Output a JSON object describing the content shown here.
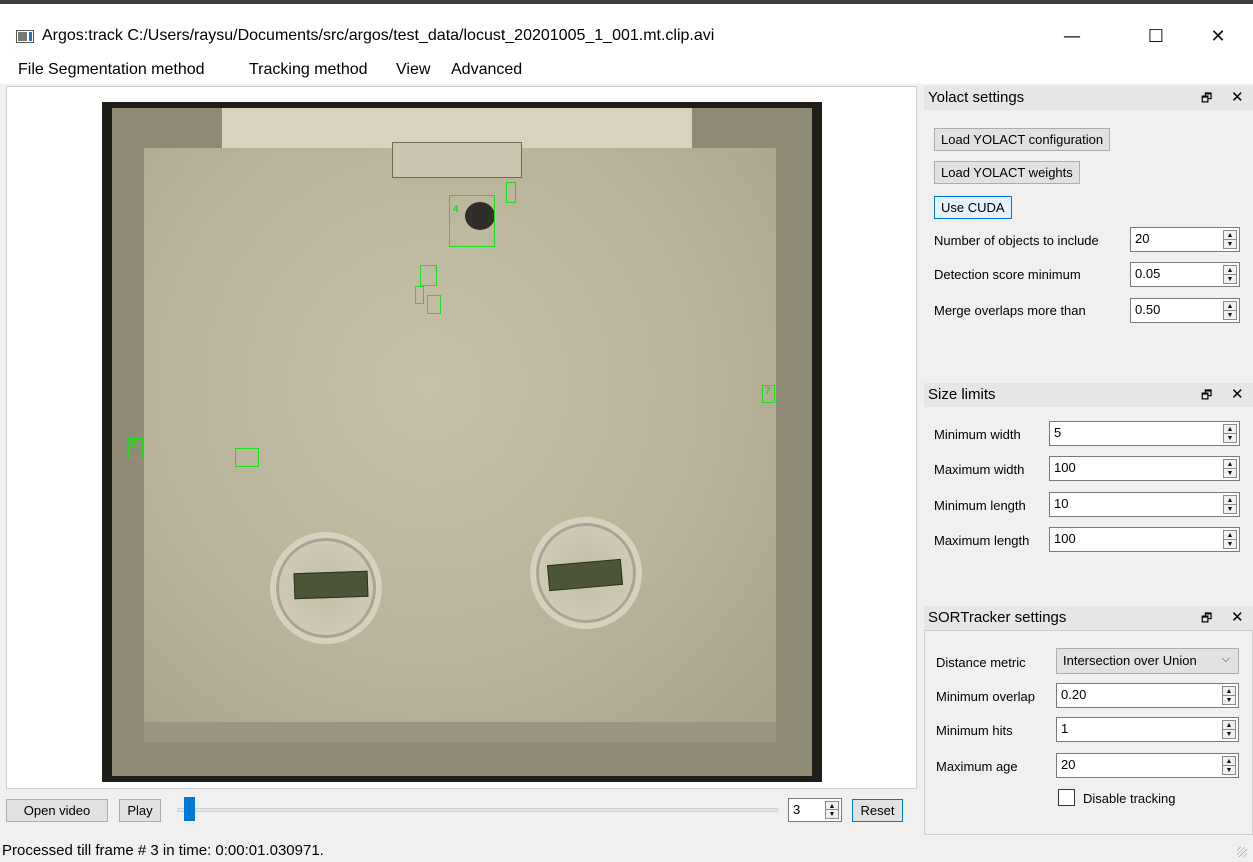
{
  "window": {
    "title": "Argos:track C:/Users/raysu/Documents/src/argos/test_data/locust_20201005_1_001.mt.clip.avi",
    "minimize": "—",
    "maximize": "☐",
    "close": "✕"
  },
  "menu": [
    "File",
    "Segmentation method",
    "Tracking method",
    "View",
    "Advanced"
  ],
  "video": {
    "detections": [
      "4",
      "7",
      "8"
    ]
  },
  "controls": {
    "open_video": "Open video",
    "play": "Play",
    "frame": "3",
    "reset": "Reset",
    "slider_fraction": 0.014
  },
  "status": "Processed till frame # 3 in time: 0:00:01.030971.",
  "dock_icons": {
    "float": "🗗",
    "close": "✕"
  },
  "spin_arrows": {
    "up": "▲",
    "down": "▼"
  },
  "yolact": {
    "title": "Yolact settings",
    "load_config": "Load YOLACT configuration",
    "load_weights": "Load YOLACT weights",
    "use_cuda": "Use CUDA",
    "fields": [
      {
        "label": "Number of objects to include",
        "value": "20"
      },
      {
        "label": "Detection score minimum",
        "value": "0.05"
      },
      {
        "label": "Merge overlaps more than",
        "value": "0.50"
      }
    ]
  },
  "size_limits": {
    "title": "Size limits",
    "fields": [
      {
        "label": "Minimum width",
        "value": "5"
      },
      {
        "label": "Maximum width",
        "value": "100"
      },
      {
        "label": "Minimum length",
        "value": "10"
      },
      {
        "label": "Maximum length",
        "value": "100"
      }
    ]
  },
  "sort": {
    "title": "SORTracker settings",
    "distance_label": "Distance metric",
    "distance_value": "Intersection over Union",
    "fields": [
      {
        "label": "Minimum overlap",
        "value": "0.20"
      },
      {
        "label": "Minimum hits",
        "value": "1"
      },
      {
        "label": "Maximum age",
        "value": "20"
      }
    ],
    "disable_tracking": "Disable tracking",
    "disable_tracking_checked": false
  },
  "colors": {
    "accent": "#0078d7",
    "detection": "#19e019"
  }
}
